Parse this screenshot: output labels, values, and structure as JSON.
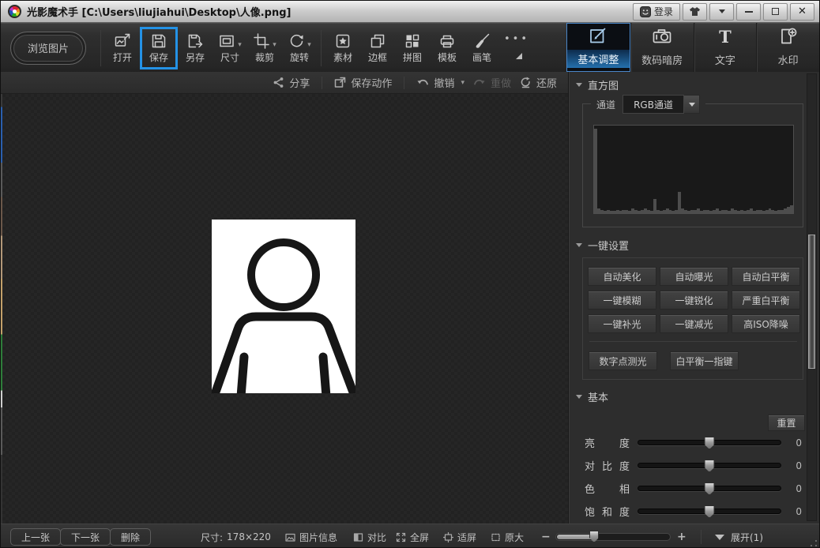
{
  "title_bar": {
    "app_title": "光影魔术手 [C:\\Users\\liujiahui\\Desktop\\人像.png]",
    "login_label": "登录"
  },
  "toolbar": {
    "browse_label": "浏览图片",
    "items": [
      {
        "label": "打开"
      },
      {
        "label": "保存"
      },
      {
        "label": "另存"
      },
      {
        "label": "尺寸"
      },
      {
        "label": "裁剪"
      },
      {
        "label": "旋转"
      },
      {
        "label": "素材"
      },
      {
        "label": "边框"
      },
      {
        "label": "拼图"
      },
      {
        "label": "模板"
      },
      {
        "label": "画笔"
      }
    ],
    "tabs": [
      {
        "label": "基本调整",
        "selected": true
      },
      {
        "label": "数码暗房"
      },
      {
        "label": "文字"
      },
      {
        "label": "水印"
      }
    ]
  },
  "action_bar": {
    "share": "分享",
    "save_action": "保存动作",
    "undo": "撤销",
    "redo": "重做",
    "restore": "还原"
  },
  "panel": {
    "histogram": {
      "header": "直方图",
      "channel_label": "通道",
      "channel_value": "RGB通道",
      "bars": [
        96,
        5,
        4,
        3,
        4,
        3,
        3,
        4,
        3,
        4,
        4,
        3,
        5,
        4,
        3,
        4,
        5,
        4,
        3,
        16,
        4,
        3,
        4,
        5,
        4,
        3,
        4,
        24,
        5,
        4,
        3,
        4,
        4,
        5,
        3,
        4,
        4,
        3,
        4,
        5,
        3,
        4,
        4,
        3,
        5,
        4,
        3,
        4,
        3,
        4,
        5,
        3,
        4,
        4,
        3,
        4,
        5,
        4,
        3,
        4,
        4,
        5,
        7,
        9
      ]
    },
    "one_click": {
      "header": "一键设置",
      "buttons": [
        "自动美化",
        "自动曝光",
        "自动白平衡",
        "一键模糊",
        "一键锐化",
        "严重白平衡",
        "一键补光",
        "一键减光",
        "高ISO降噪"
      ],
      "extra_buttons": [
        "数字点测光",
        "白平衡一指键"
      ]
    },
    "basic": {
      "header": "基本",
      "reset_label": "重置",
      "sliders": [
        {
          "label": "亮度",
          "value": 0
        },
        {
          "label": "对比度",
          "value": 0
        },
        {
          "label": "色相",
          "value": 0
        },
        {
          "label": "饱和度",
          "value": 0
        }
      ]
    }
  },
  "status_bar": {
    "prev": "上一张",
    "next": "下一张",
    "delete": "删除",
    "size_label": "尺寸:",
    "size_value": "178×220",
    "image_info": "图片信息",
    "compare": "对比",
    "fullscreen": "全屏",
    "fit_screen": "适屏",
    "original_size": "原大",
    "expand": "展开(1)"
  },
  "colors": {
    "accent_blue": "#2492e6",
    "selected_tab_border": "#4a86c8",
    "histogram_bar": "#4d4d4d"
  }
}
